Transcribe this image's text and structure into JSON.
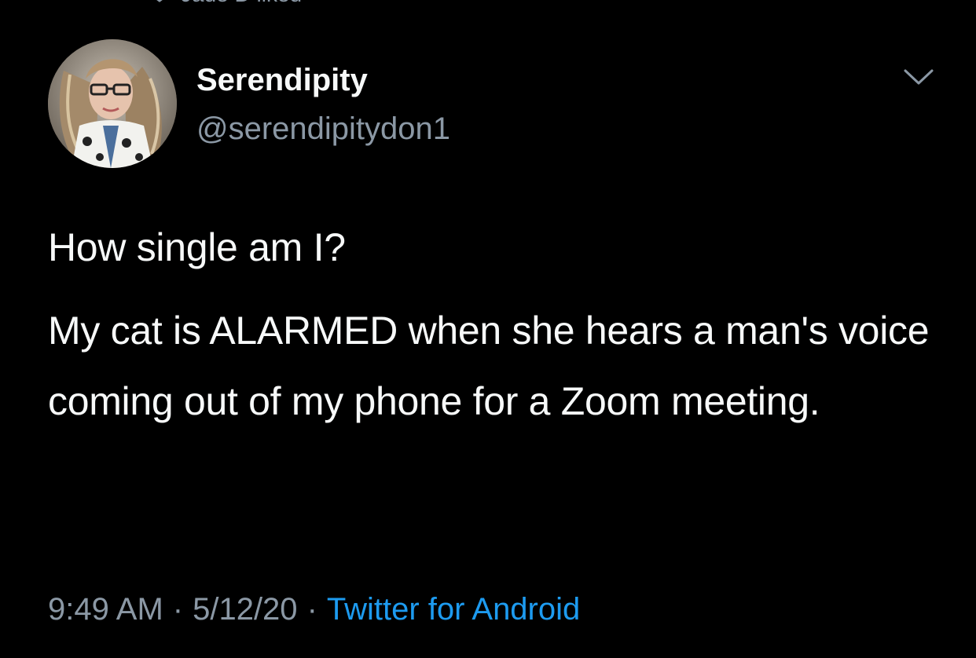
{
  "social_context": {
    "text": "Jade D liked",
    "icon": "heart-icon"
  },
  "author": {
    "display_name": "Serendipity",
    "handle": "@serendipitydon1",
    "avatar": "avatar-photo"
  },
  "menu": {
    "icon": "chevron-down-icon"
  },
  "tweet": {
    "line_1": "How single am I?",
    "line_2": "My cat is ALARMED when she hears a man's voice coming out of my phone for a Zoom meeting."
  },
  "meta": {
    "time": "9:49 AM",
    "date": "5/12/20",
    "separator": "·",
    "source": "Twitter for Android"
  },
  "colors": {
    "background": "#000000",
    "primary_text": "#f7f9f9",
    "secondary_text": "#8b98a5",
    "link": "#1d9bf0"
  }
}
